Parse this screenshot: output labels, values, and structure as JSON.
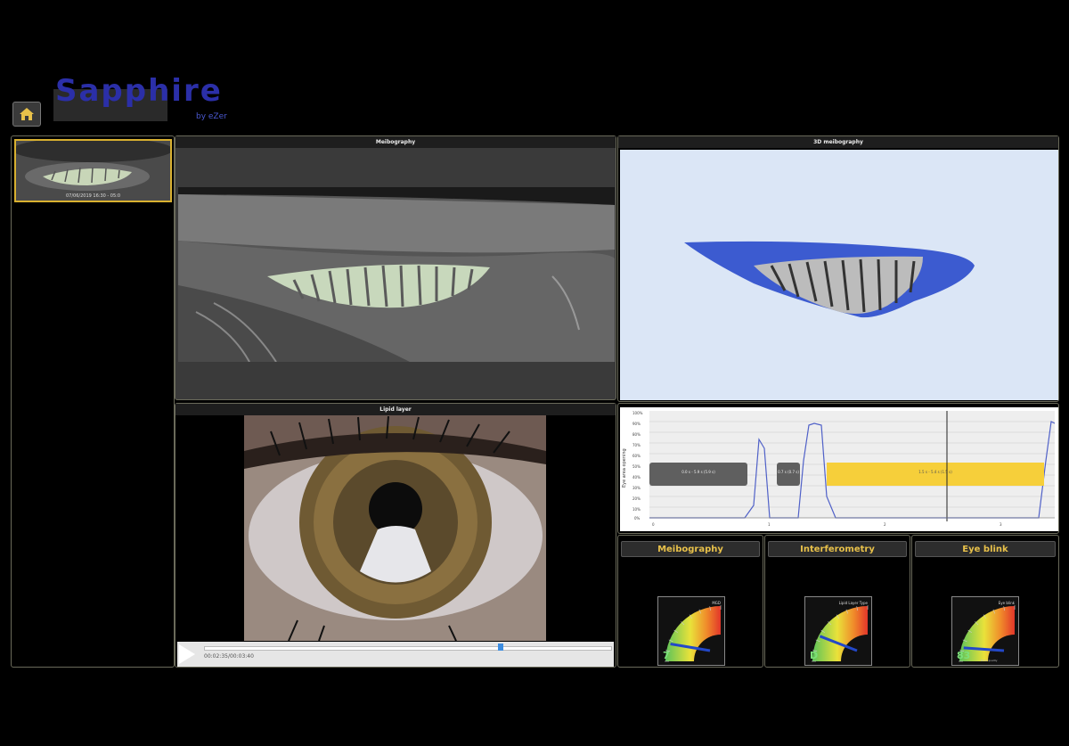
{
  "header": {
    "logo_text": "Sapphire",
    "logo_sub": "by eZer",
    "home_icon": "home-icon"
  },
  "thumbnail": {
    "caption": "07/06/2019 16:30 - 05:0"
  },
  "panels": {
    "meibography_title": "Meibography",
    "three_d_title": "3D meibography",
    "lipid_title": "Lipid layer"
  },
  "player": {
    "timecode": "00:02:35/00:03:40",
    "progress": 0.73
  },
  "blink_chart": {
    "ylabel": "Eye area opening",
    "bar1": "0.0 s - 5.9 s\n(5.9 s)",
    "bar2": "0.7 s\n(0.7 s)",
    "bar3": "1.5 s - 5.4 s\n(1.5 s)",
    "y_ticks": [
      "100%",
      "90%",
      "80%",
      "70%",
      "60%",
      "50%",
      "40%",
      "30%",
      "20%",
      "10%",
      "0%"
    ],
    "x_ticks": [
      "0",
      "1",
      "2",
      "3"
    ]
  },
  "gauges": [
    {
      "title": "Meibography",
      "label": "MGD",
      "value": "7",
      "level": 0.15
    },
    {
      "title": "Interferometry",
      "label": "Lipid Layer Type",
      "value": "D",
      "level": 0.25
    },
    {
      "title": "Eye blink",
      "label": "Eye blink",
      "value": "83",
      "level": 0.1,
      "unit": "Blink quality"
    }
  ],
  "colors": {
    "accent_gold": "#e8c14a",
    "logo_blue": "#2b2fa8",
    "gland_blue": "#3c5bd0",
    "bar_yellow": "#f6cf3a"
  }
}
